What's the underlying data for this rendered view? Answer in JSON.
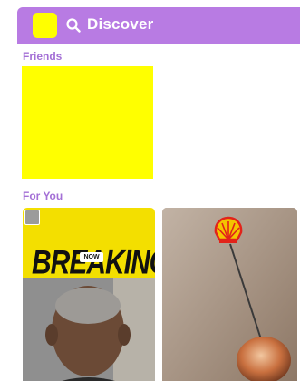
{
  "header": {
    "title": "Discover",
    "accent_color": "#b87be3",
    "avatar_color": "#ffff00"
  },
  "friends": {
    "label": "Friends",
    "tile_color": "#ffff00"
  },
  "for_you": {
    "label": "For You",
    "cards": [
      {
        "headline": "BREAKING",
        "badge": "NOW",
        "background": "#f3df00"
      },
      {
        "brand_logo": "shell-logo-icon"
      }
    ]
  }
}
